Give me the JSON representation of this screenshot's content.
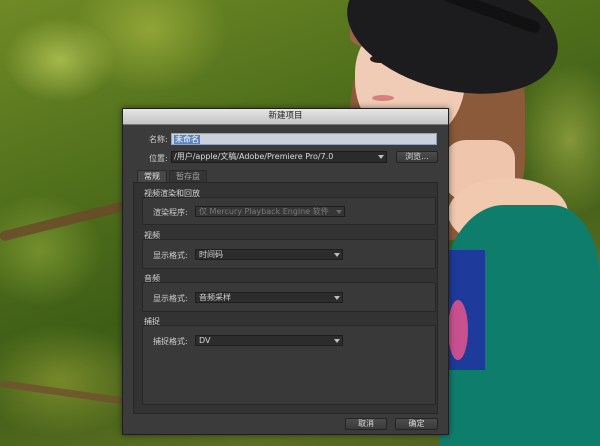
{
  "dialog": {
    "title": "新建项目",
    "name_label": "名称:",
    "name_value": "未命名",
    "location_label": "位置:",
    "location_value": "/用户/apple/文稿/Adobe/Premiere Pro/7.0",
    "browse_button": "浏览...",
    "tabs": [
      {
        "label": "常规",
        "active": true
      },
      {
        "label": "暂存盘",
        "active": false
      }
    ],
    "sections": {
      "renderer": {
        "title": "视频渲染和回放",
        "field_label": "渲染程序:",
        "value": "仅 Mercury Playback Engine 软件",
        "disabled": true
      },
      "video": {
        "title": "视频",
        "field_label": "显示格式:",
        "value": "时间码"
      },
      "audio": {
        "title": "音频",
        "field_label": "显示格式:",
        "value": "音频采样"
      },
      "capture": {
        "title": "捕捉",
        "field_label": "捕捉格式:",
        "value": "DV"
      }
    },
    "cancel_button": "取消",
    "ok_button": "确定"
  },
  "colors": {
    "dialog_bg": "#3b3b3b",
    "titlebar": "#d6d6d6",
    "selection": "#5b85c0"
  }
}
